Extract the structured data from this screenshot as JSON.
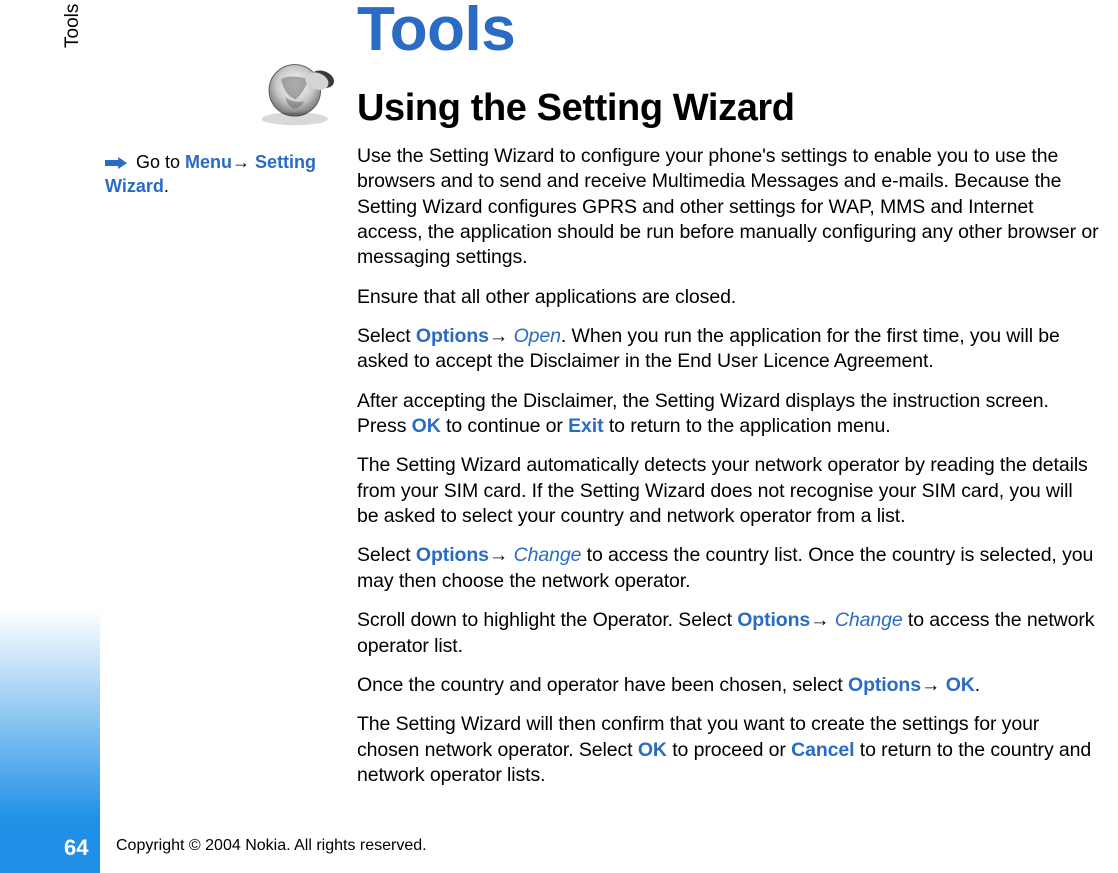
{
  "sideTab": "Tools",
  "pageNumber": "64",
  "copyright": "Copyright © 2004 Nokia. All rights reserved.",
  "navHint": {
    "prefix": " Go to ",
    "menu": "Menu",
    "arrow": "→",
    "settingWizard": "Setting Wizard",
    "period": "."
  },
  "headings": {
    "h1": "Tools",
    "h2": "Using the Setting Wizard"
  },
  "para1": "Use the Setting Wizard to configure your phone's settings to enable you to use the browsers and to send and receive Multimedia Messages and e-mails. Because the Setting Wizard configures GPRS and other settings for WAP, MMS and Internet access, the application should be run before manually configuring any other browser or messaging settings.",
  "para2": "Ensure that all other applications are closed.",
  "para3": {
    "t1": "Select ",
    "options": "Options",
    "arrow": "→ ",
    "open": "Open",
    "t2": ". When you run the application for the first time, you will be asked to accept the Disclaimer in the End User Licence Agreement."
  },
  "para4": {
    "t1": "After accepting the Disclaimer, the Setting Wizard displays the instruction screen. Press ",
    "ok": "OK",
    "t2": " to continue or ",
    "exit": "Exit",
    "t3": " to return to the application menu."
  },
  "para5": "The Setting Wizard automatically detects your network operator by reading the details from your SIM card. If the Setting Wizard does not recognise your SIM card, you will be asked to select your country and network operator from a list.",
  "para6": {
    "t1": "Select ",
    "options": "Options",
    "arrow": "→ ",
    "change": "Change",
    "t2": " to access the country list. Once the country is selected, you may then choose the network operator."
  },
  "para7": {
    "t1": "Scroll down to highlight the Operator. Select ",
    "options": "Options",
    "arrow": "→ ",
    "change": "Change",
    "t2": " to access the network operator list."
  },
  "para8": {
    "t1": "Once the country and operator have been chosen, select ",
    "options": "Options",
    "arrow": "→ ",
    "ok": "OK",
    "period": "."
  },
  "para9": {
    "t1": "The Setting Wizard will then confirm that you want to create the settings for your chosen network operator. Select ",
    "ok": "OK",
    "t2": " to proceed or ",
    "cancel": "Cancel",
    "t3": " to return to the country and network operator lists."
  }
}
